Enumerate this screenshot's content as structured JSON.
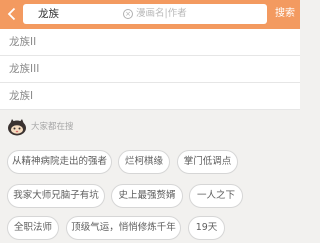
{
  "search": {
    "query": "龙族",
    "placeholder": "漫画名|作者",
    "button_label": "搜索"
  },
  "suggestions": [
    "龙族II",
    "龙族III",
    "龙族I"
  ],
  "hot_section": {
    "title": "大家都在搜"
  },
  "tags": [
    "从精神病院走出的强者",
    "烂柯棋缘",
    "掌门低调点",
    "我家大师兄脑子有坑",
    "史上最强赘婿",
    "一人之下",
    "全职法师",
    "顶级气运，悄悄修炼千年",
    "19天"
  ],
  "colors": {
    "header": "#f39a60",
    "background": "#f2f1ef"
  }
}
